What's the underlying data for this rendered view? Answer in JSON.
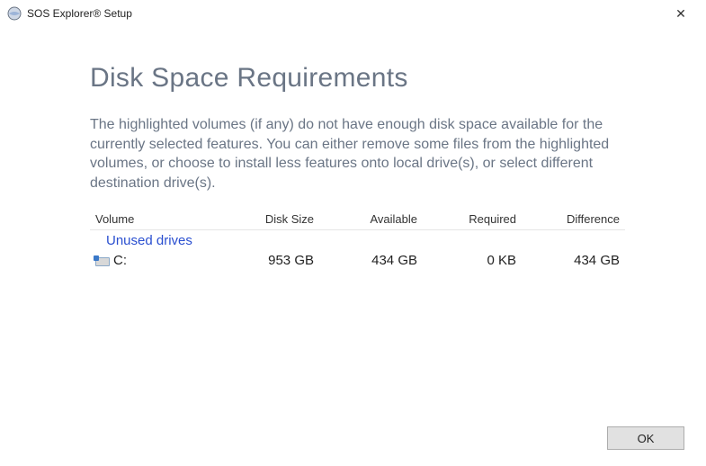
{
  "window": {
    "title": "SOS Explorer® Setup",
    "close_glyph": "✕"
  },
  "page": {
    "heading": "Disk Space Requirements",
    "description": "The highlighted volumes (if any) do not have enough disk space available for the currently selected features.  You can either remove some files from the highlighted volumes, or choose to install less features onto local drive(s), or select different destination       drive(s)."
  },
  "table": {
    "columns": {
      "volume": "Volume",
      "disk_size": "Disk Size",
      "available": "Available",
      "required": "Required",
      "difference": "Difference"
    },
    "group_label": "Unused drives",
    "rows": [
      {
        "volume": "C:",
        "disk_size": "953 GB",
        "available": "434 GB",
        "required": "0 KB",
        "difference": "434 GB"
      }
    ]
  },
  "buttons": {
    "ok": "OK"
  }
}
